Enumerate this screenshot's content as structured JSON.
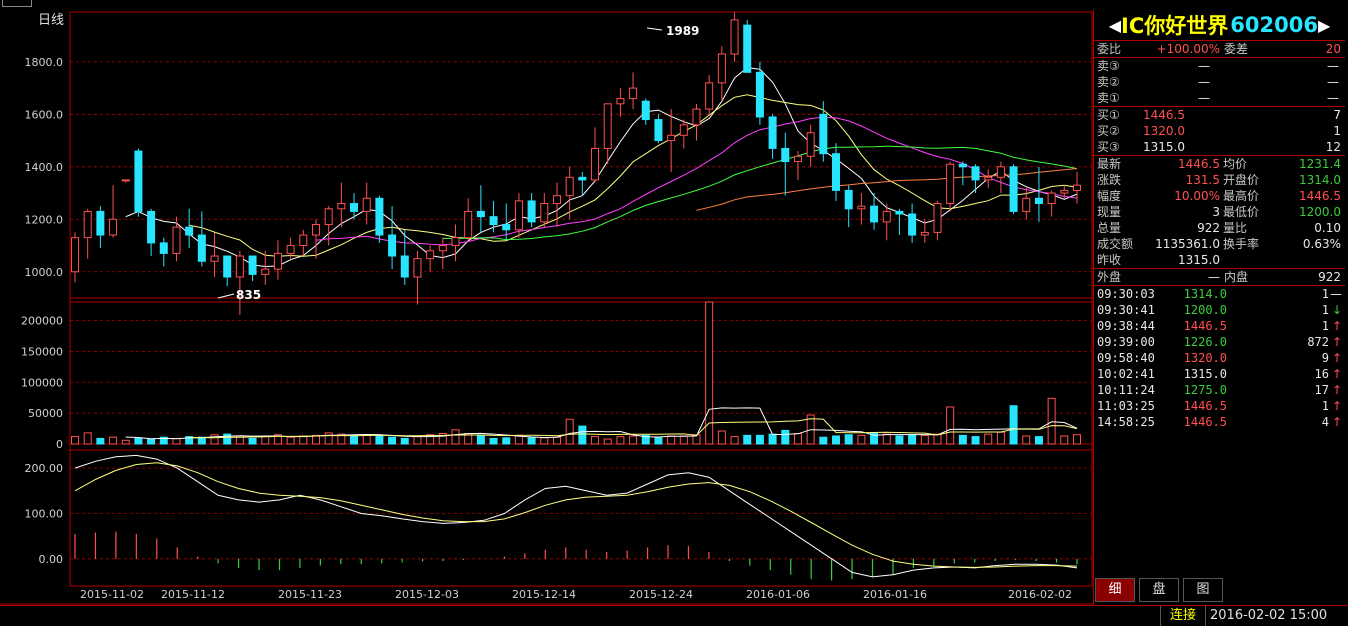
{
  "chart": {
    "period_label": "日线",
    "price_axis": [
      "1800.0",
      "1600.0",
      "1400.0",
      "1200.0",
      "1000.0"
    ],
    "volume_axis": [
      "200000",
      "150000",
      "100000",
      "50000",
      "0"
    ],
    "indicator_axis": [
      "200.00",
      "100.00",
      "0.00"
    ],
    "dates": [
      "2015-11-02",
      "2015-11-12",
      "2015-11-23",
      "2015-12-03",
      "2015-12-14",
      "2015-12-24",
      "2016-01-06",
      "2016-01-16",
      "2016-02-02"
    ],
    "high_mark": "1989",
    "low_mark": "835",
    "colors": {
      "up": "#ff5050",
      "down": "#28e4ff",
      "grid": "#b00000",
      "ma5": "#ffffff",
      "ma10": "#ffff80",
      "ma20": "#ff40ff",
      "ma30": "#40ff40",
      "ma60": "#ff8040"
    }
  },
  "chart_data": {
    "type": "candlestick",
    "title": "",
    "ylim_price": [
      900,
      1990
    ],
    "ylim_volume": [
      0,
      230000
    ],
    "ylim_indicator": [
      -60,
      240
    ],
    "candles": [
      [
        1000,
        1150,
        960,
        1130
      ],
      [
        1130,
        1240,
        1050,
        1230
      ],
      [
        1230,
        1250,
        1090,
        1140
      ],
      [
        1140,
        1330,
        1130,
        1200
      ],
      [
        1350,
        1350,
        1340,
        1350
      ],
      [
        1460,
        1470,
        1210,
        1230
      ],
      [
        1230,
        1240,
        1060,
        1110
      ],
      [
        1110,
        1130,
        1020,
        1070
      ],
      [
        1070,
        1210,
        1040,
        1170
      ],
      [
        1170,
        1240,
        1090,
        1140
      ],
      [
        1140,
        1230,
        1020,
        1040
      ],
      [
        1040,
        1150,
        980,
        1060
      ],
      [
        1060,
        1060,
        945,
        980
      ],
      [
        980,
        1080,
        835,
        1060
      ],
      [
        1060,
        1060,
        965,
        990
      ],
      [
        990,
        1080,
        950,
        1010
      ],
      [
        1010,
        1120,
        970,
        1070
      ],
      [
        1070,
        1130,
        1050,
        1100
      ],
      [
        1100,
        1160,
        1060,
        1140
      ],
      [
        1140,
        1200,
        1050,
        1180
      ],
      [
        1180,
        1250,
        1100,
        1240
      ],
      [
        1240,
        1340,
        1170,
        1260
      ],
      [
        1260,
        1300,
        1200,
        1230
      ],
      [
        1230,
        1340,
        1180,
        1280
      ],
      [
        1280,
        1290,
        1110,
        1140
      ],
      [
        1140,
        1250,
        1010,
        1060
      ],
      [
        1060,
        1160,
        950,
        980
      ],
      [
        980,
        1080,
        875,
        1050
      ],
      [
        1050,
        1100,
        1000,
        1080
      ],
      [
        1080,
        1130,
        1010,
        1100
      ],
      [
        1100,
        1180,
        1040,
        1130
      ],
      [
        1130,
        1280,
        1120,
        1230
      ],
      [
        1230,
        1330,
        1150,
        1210
      ],
      [
        1210,
        1270,
        1150,
        1180
      ],
      [
        1180,
        1260,
        1120,
        1160
      ],
      [
        1160,
        1300,
        1130,
        1270
      ],
      [
        1270,
        1300,
        1170,
        1190
      ],
      [
        1190,
        1300,
        1170,
        1260
      ],
      [
        1260,
        1340,
        1170,
        1290
      ],
      [
        1290,
        1400,
        1200,
        1360
      ],
      [
        1360,
        1380,
        1290,
        1350
      ],
      [
        1350,
        1550,
        1340,
        1470
      ],
      [
        1470,
        1600,
        1410,
        1640
      ],
      [
        1640,
        1700,
        1590,
        1660
      ],
      [
        1660,
        1760,
        1620,
        1700
      ],
      [
        1650,
        1660,
        1560,
        1580
      ],
      [
        1580,
        1600,
        1490,
        1500
      ],
      [
        1500,
        1620,
        1380,
        1520
      ],
      [
        1520,
        1580,
        1470,
        1560
      ],
      [
        1560,
        1640,
        1500,
        1620
      ],
      [
        1620,
        1750,
        1600,
        1720
      ],
      [
        1720,
        1860,
        1650,
        1830
      ],
      [
        1830,
        1989,
        1800,
        1960
      ],
      [
        1940,
        1960,
        1760,
        1760
      ],
      [
        1760,
        1800,
        1560,
        1590
      ],
      [
        1590,
        1600,
        1430,
        1470
      ],
      [
        1470,
        1530,
        1290,
        1420
      ],
      [
        1420,
        1460,
        1350,
        1440
      ],
      [
        1440,
        1560,
        1400,
        1530
      ],
      [
        1600,
        1650,
        1420,
        1450
      ],
      [
        1450,
        1490,
        1270,
        1310
      ],
      [
        1310,
        1330,
        1170,
        1240
      ],
      [
        1240,
        1300,
        1180,
        1250
      ],
      [
        1250,
        1300,
        1160,
        1190
      ],
      [
        1190,
        1260,
        1120,
        1230
      ],
      [
        1230,
        1240,
        1140,
        1220
      ],
      [
        1220,
        1260,
        1110,
        1140
      ],
      [
        1140,
        1200,
        1110,
        1150
      ],
      [
        1150,
        1270,
        1120,
        1260
      ],
      [
        1260,
        1420,
        1230,
        1410
      ],
      [
        1410,
        1420,
        1330,
        1400
      ],
      [
        1400,
        1410,
        1300,
        1350
      ],
      [
        1350,
        1390,
        1320,
        1360
      ],
      [
        1360,
        1420,
        1300,
        1400
      ],
      [
        1400,
        1410,
        1220,
        1230
      ],
      [
        1230,
        1320,
        1200,
        1280
      ],
      [
        1280,
        1400,
        1190,
        1260
      ],
      [
        1260,
        1310,
        1210,
        1300
      ],
      [
        1300,
        1330,
        1280,
        1310
      ],
      [
        1310,
        1380,
        1260,
        1330
      ]
    ],
    "volume": [
      12000,
      18000,
      9000,
      11000,
      6000,
      9000,
      8000,
      11000,
      9000,
      12000,
      11000,
      15000,
      16000,
      13000,
      9000,
      12000,
      15000,
      11000,
      13000,
      14000,
      18000,
      16000,
      14000,
      15000,
      13000,
      11000,
      9000,
      12000,
      15000,
      17000,
      23000,
      17000,
      14000,
      9000,
      10000,
      14000,
      10000,
      10000,
      11000,
      40000,
      29000,
      12000,
      8000,
      12000,
      13000,
      14000,
      10000,
      13000,
      13000,
      15000,
      230000,
      21000,
      12000,
      14000,
      14000,
      16000,
      22000,
      17000,
      47000,
      11000,
      13000,
      15000,
      14000,
      18000,
      16000,
      13000,
      15000,
      14000,
      16000,
      60000,
      14000,
      12000,
      16000,
      19000,
      62000,
      13000,
      12000,
      74000,
      13000,
      15000
    ],
    "ind_line1": [
      200,
      215,
      225,
      228,
      220,
      200,
      170,
      140,
      130,
      125,
      130,
      140,
      130,
      115,
      100,
      95,
      88,
      82,
      78,
      80,
      85,
      100,
      130,
      155,
      160,
      150,
      140,
      145,
      165,
      185,
      190,
      180,
      150,
      120,
      90,
      60,
      30,
      0,
      -30,
      -40,
      -35,
      -25,
      -20,
      -18,
      -20,
      -15,
      -12,
      -12,
      -14,
      -20
    ],
    "ind_line2": [
      150,
      175,
      195,
      208,
      212,
      205,
      190,
      170,
      155,
      145,
      140,
      138,
      135,
      128,
      118,
      108,
      98,
      90,
      84,
      82,
      82,
      88,
      102,
      118,
      130,
      136,
      138,
      140,
      148,
      158,
      165,
      168,
      162,
      148,
      128,
      105,
      80,
      55,
      30,
      10,
      -5,
      -12,
      -16,
      -18,
      -19,
      -18,
      -16,
      -15,
      -15,
      -16
    ],
    "ind_bars": [
      55,
      58,
      60,
      55,
      45,
      25,
      5,
      -10,
      -20,
      -25,
      -25,
      -20,
      -15,
      -12,
      -12,
      -10,
      -8,
      -6,
      -5,
      -3,
      0,
      5,
      12,
      20,
      25,
      20,
      15,
      18,
      25,
      30,
      28,
      15,
      -5,
      -15,
      -25,
      -35,
      -45,
      -48,
      -45,
      -40,
      -35,
      -20,
      -15,
      -10,
      -8,
      -5,
      -3,
      -5,
      -8,
      -12
    ]
  },
  "quote": {
    "title_arrow_left": "◀",
    "title_arrow_right": "▶",
    "stock_name": "IC你好世界",
    "stock_code": "602006",
    "ratio_label": "委比",
    "ratio_value": "+100.00%",
    "diff_label": "委差",
    "diff_value": "20",
    "asks": [
      {
        "label": "卖③",
        "price": "—",
        "vol": "—"
      },
      {
        "label": "卖②",
        "price": "—",
        "vol": "—"
      },
      {
        "label": "卖①",
        "price": "—",
        "vol": "—"
      }
    ],
    "bids": [
      {
        "label": "买①",
        "price": "1446.5",
        "vol": "7"
      },
      {
        "label": "买②",
        "price": "1320.0",
        "vol": "1"
      },
      {
        "label": "买③",
        "price": "1315.0",
        "vol": "12"
      }
    ],
    "stats": [
      {
        "l1": "最新",
        "v1": "1446.5",
        "c1": "red",
        "l2": "均价",
        "v2": "1231.4",
        "c2": "grn"
      },
      {
        "l1": "涨跌",
        "v1": "131.5",
        "c1": "red",
        "l2": "开盘价",
        "v2": "1314.0",
        "c2": "grn"
      },
      {
        "l1": "幅度",
        "v1": "10.00%",
        "c1": "red",
        "l2": "最高价",
        "v2": "1446.5",
        "c2": "red"
      },
      {
        "l1": "现量",
        "v1": "3",
        "c1": "wht",
        "l2": "最低价",
        "v2": "1200.0",
        "c2": "grn"
      },
      {
        "l1": "总量",
        "v1": "922",
        "c1": "wht",
        "l2": "量比",
        "v2": "0.10",
        "c2": "wht"
      },
      {
        "l1": "成交额",
        "v1": "1135361.0",
        "c1": "wht",
        "l2": "换手率",
        "v2": "0.63%",
        "c2": "wht"
      },
      {
        "l1": "昨收",
        "v1": "1315.0",
        "c1": "wht",
        "l2": "",
        "v2": "",
        "c2": "wht"
      }
    ],
    "outer_label": "外盘",
    "outer_value": "—",
    "inner_label": "内盘",
    "inner_value": "922",
    "ticks": [
      {
        "time": "09:30:03",
        "price": "1314.0",
        "pc": "grn",
        "vol": "1",
        "dir": "—",
        "dc": "wht"
      },
      {
        "time": "09:30:41",
        "price": "1200.0",
        "pc": "grn",
        "vol": "1",
        "dir": "↓",
        "dc": "grn"
      },
      {
        "time": "09:38:44",
        "price": "1446.5",
        "pc": "red",
        "vol": "1",
        "dir": "↑",
        "dc": "red"
      },
      {
        "time": "09:39:00",
        "price": "1226.0",
        "pc": "grn",
        "vol": "872",
        "dir": "↑",
        "dc": "red"
      },
      {
        "time": "09:58:40",
        "price": "1320.0",
        "pc": "red",
        "vol": "9",
        "dir": "↑",
        "dc": "red"
      },
      {
        "time": "10:02:41",
        "price": "1315.0",
        "pc": "wht",
        "vol": "16",
        "dir": "↑",
        "dc": "red"
      },
      {
        "time": "10:11:24",
        "price": "1275.0",
        "pc": "grn",
        "vol": "17",
        "dir": "↑",
        "dc": "red"
      },
      {
        "time": "11:03:25",
        "price": "1446.5",
        "pc": "red",
        "vol": "1",
        "dir": "↑",
        "dc": "red"
      },
      {
        "time": "14:58:25",
        "price": "1446.5",
        "pc": "red",
        "vol": "4",
        "dir": "↑",
        "dc": "red"
      }
    ],
    "tabs": [
      "细",
      "盘",
      "图"
    ]
  },
  "status": {
    "connection": "连接",
    "datetime": "2016-02-02 15:00"
  }
}
